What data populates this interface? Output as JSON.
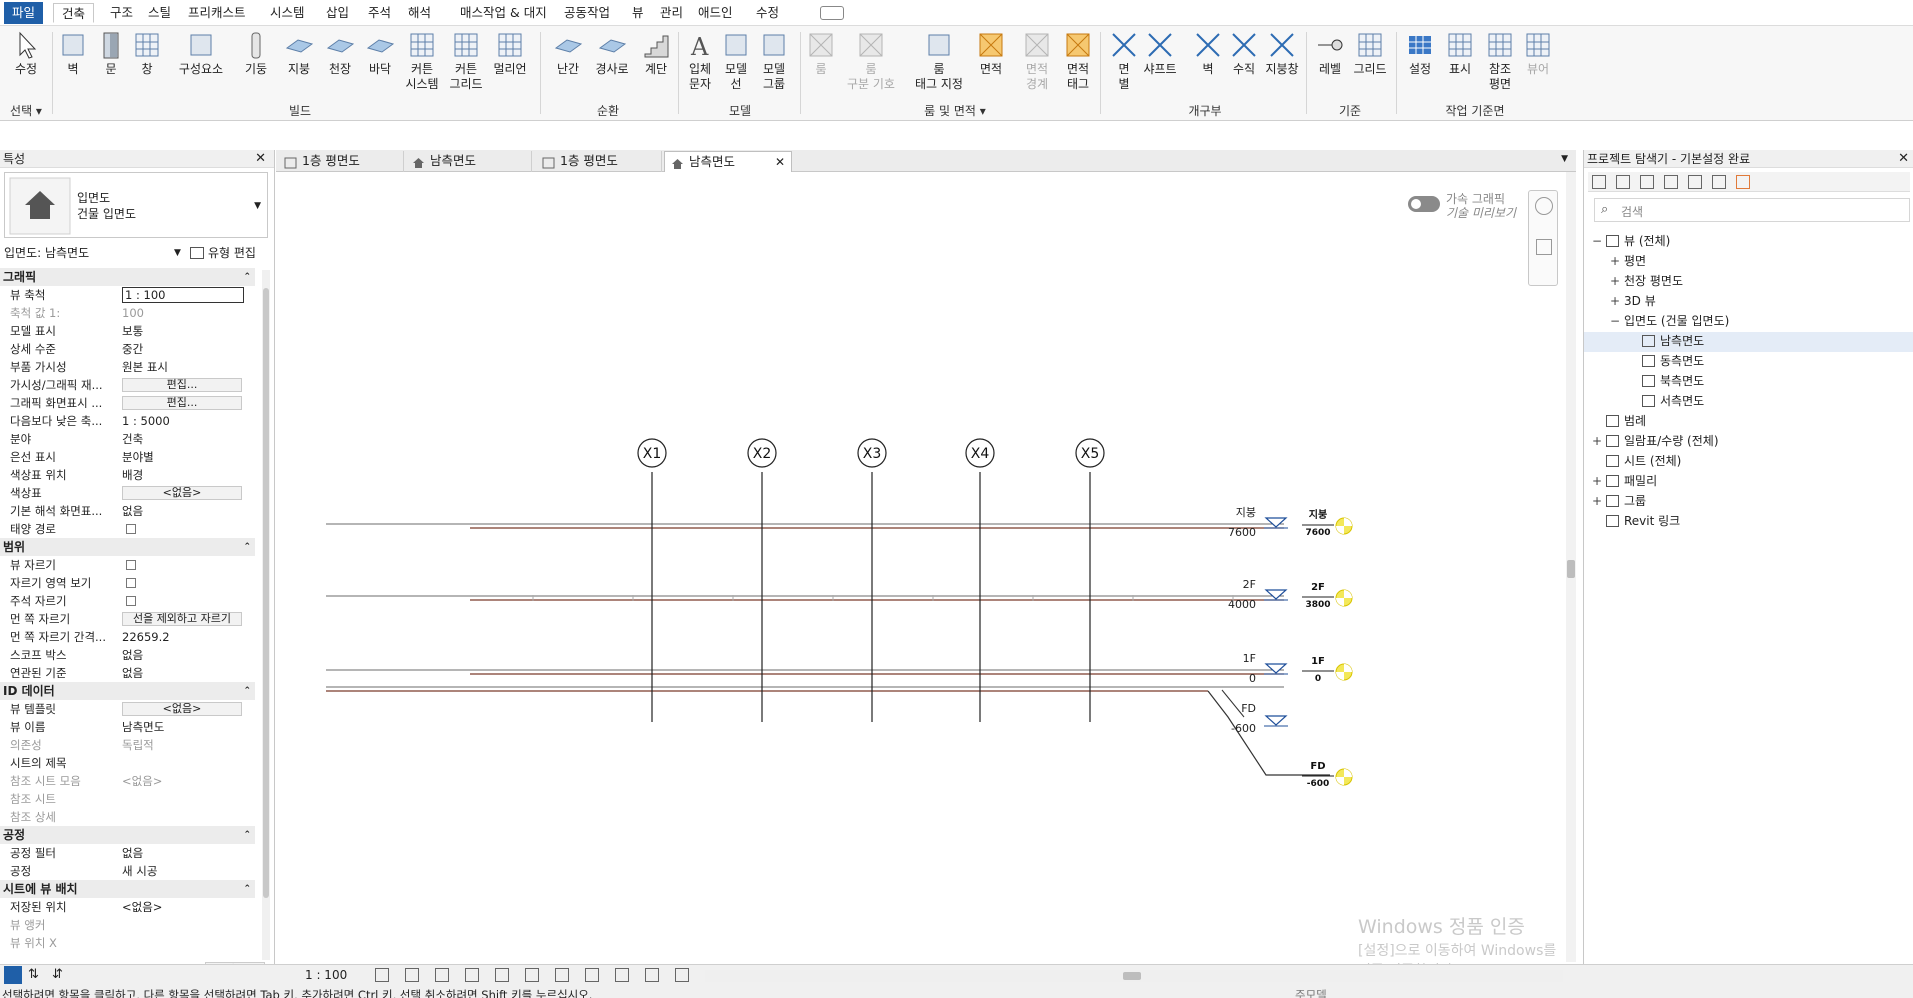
{
  "menu": {
    "file": "파일",
    "tabs": [
      "건축",
      "구조",
      "스틸",
      "프리캐스트",
      "시스템",
      "삽입",
      "주석",
      "해석",
      "매스작업 & 대지",
      "공동작업",
      "뷰",
      "관리",
      "애드인",
      "수정"
    ],
    "active": "건축"
  },
  "ribbon": {
    "select": {
      "modify": "수정",
      "group": "선택"
    },
    "build": [
      "벽",
      "문",
      "창",
      "구성요소",
      "기둥",
      "지붕",
      "천장",
      "바닥",
      "커튼\n시스템",
      "커튼\n그리드",
      "멀리언"
    ],
    "build_group": "빌드",
    "circulation": [
      "난간",
      "경사로",
      "계단"
    ],
    "circulation_group": "순환",
    "model": [
      "입체\n문자",
      "모델\n선",
      "모델\n그룹"
    ],
    "model_group": "모델",
    "room": [
      "룸",
      "룸\n구분 기호",
      "룸\n태그 지정",
      "면적",
      "면적\n경계",
      "면적\n태그"
    ],
    "room_group": "룸 및 면적",
    "opening": [
      "면\n별",
      "샤프트",
      "벽",
      "수직",
      "지붕창"
    ],
    "opening_group": "개구부",
    "datum": [
      "레벨",
      "그리드"
    ],
    "datum_group": "기준",
    "workplane": [
      "설정",
      "표시",
      "참조\n평면",
      "뷰어"
    ],
    "workplane_group": "작업 기준면"
  },
  "properties": {
    "title": "특성",
    "type_name": "입면도",
    "type_sub": "건물 입면도",
    "selector": "입면도: 남측면도",
    "edit_type": "유형 편집",
    "apply": "적용",
    "sections": [
      {
        "name": "그래픽",
        "rows": [
          {
            "k": "뷰 축척",
            "v": "1 : 100",
            "kind": "input"
          },
          {
            "k": "축척 값    1:",
            "v": "100",
            "kind": "gray"
          },
          {
            "k": "모델 표시",
            "v": "보통"
          },
          {
            "k": "상세 수준",
            "v": "중간"
          },
          {
            "k": "부품 가시성",
            "v": "원본 표시"
          },
          {
            "k": "가시성/그래픽 재...",
            "v": "편집...",
            "kind": "btn"
          },
          {
            "k": "그래픽 화면표시 ...",
            "v": "편집...",
            "kind": "btn"
          },
          {
            "k": "다음보다 낮은 축...",
            "v": "1 : 5000"
          },
          {
            "k": "분야",
            "v": "건축"
          },
          {
            "k": "은선 표시",
            "v": "분야별"
          },
          {
            "k": "색상표 위치",
            "v": "배경"
          },
          {
            "k": "색상표",
            "v": "<없음>",
            "kind": "btn"
          },
          {
            "k": "기본 해석 화면표...",
            "v": "없음"
          },
          {
            "k": "태양 경로",
            "v": "",
            "kind": "cb"
          }
        ]
      },
      {
        "name": "범위",
        "rows": [
          {
            "k": "뷰 자르기",
            "v": "",
            "kind": "cb"
          },
          {
            "k": "자르기 영역 보기",
            "v": "",
            "kind": "cb"
          },
          {
            "k": "주석 자르기",
            "v": "",
            "kind": "cb"
          },
          {
            "k": "먼 쪽 자르기",
            "v": "선을 제외하고 자르기",
            "kind": "btn"
          },
          {
            "k": "먼 쪽 자르기 간격...",
            "v": "22659.2"
          },
          {
            "k": "스코프 박스",
            "v": "없음"
          },
          {
            "k": "연관된 기준",
            "v": "없음"
          }
        ]
      },
      {
        "name": "ID 데이터",
        "rows": [
          {
            "k": "뷰 템플릿",
            "v": "<없음>",
            "kind": "btn"
          },
          {
            "k": "뷰 이름",
            "v": "남측면도"
          },
          {
            "k": "의존성",
            "v": "독립적",
            "kind": "gray"
          },
          {
            "k": "시트의 제목",
            "v": ""
          },
          {
            "k": "참조 시트 모음",
            "v": "<없음>",
            "kind": "gray"
          },
          {
            "k": "참조 시트",
            "v": "",
            "kind": "gray"
          },
          {
            "k": "참조 상세",
            "v": "",
            "kind": "gray"
          }
        ]
      },
      {
        "name": "공정",
        "rows": [
          {
            "k": "공정 필터",
            "v": "없음"
          },
          {
            "k": "공정",
            "v": "새 시공"
          }
        ]
      },
      {
        "name": "시트에 뷰 배치",
        "rows": [
          {
            "k": "저장된 위치",
            "v": "<없음>"
          },
          {
            "k": "뷰 앵커",
            "v": "",
            "kind": "gray"
          },
          {
            "k": "뷰 위치 X",
            "v": "",
            "kind": "gray"
          }
        ]
      }
    ]
  },
  "tabs": [
    {
      "label": "1층 평면도",
      "icon": "plan"
    },
    {
      "label": "남측면도",
      "icon": "elev"
    },
    {
      "label": "1층 평면도",
      "icon": "plan"
    },
    {
      "label": "남측면도",
      "icon": "elev",
      "active": true
    }
  ],
  "canvas": {
    "toggle_label": "가속 그래픽",
    "toggle_sub": "기술 미리보기",
    "grids": [
      "X1",
      "X2",
      "X3",
      "X4",
      "X5"
    ],
    "levels": [
      {
        "name": "지붕",
        "elev": "7600",
        "tag": "지붕",
        "tagv": "7600"
      },
      {
        "name": "2F",
        "elev": "4000",
        "tag": "2F",
        "tagv": "3800"
      },
      {
        "name": "1F",
        "elev": "0",
        "tag": "1F",
        "tagv": "0"
      },
      {
        "name": "FD",
        "elev": "-600",
        "tag": "FD",
        "tagv": "-600"
      }
    ],
    "watermark_title": "Windows 정품 인증",
    "watermark_sub": "[설정]으로 이동하여 Windows를 정품 인증합니다.",
    "scale": "1 : 100"
  },
  "browser": {
    "title": "프로젝트 탐색기 - 기본설정 완료",
    "search": "검색",
    "tree": [
      {
        "t": "뷰 (전체)",
        "lvl": 0,
        "pm": "−",
        "icon": true
      },
      {
        "t": "평면",
        "lvl": 1,
        "pm": "+"
      },
      {
        "t": "천장 평면도",
        "lvl": 1,
        "pm": "+"
      },
      {
        "t": "3D 뷰",
        "lvl": 1,
        "pm": "+"
      },
      {
        "t": "입면도 (건물 입면도)",
        "lvl": 1,
        "pm": "−"
      },
      {
        "t": "남측면도",
        "lvl": 2,
        "pm": "",
        "sel": true,
        "icon": true
      },
      {
        "t": "동측면도",
        "lvl": 2,
        "pm": "",
        "icon": true
      },
      {
        "t": "북측면도",
        "lvl": 2,
        "pm": "",
        "icon": true
      },
      {
        "t": "서측면도",
        "lvl": 2,
        "pm": "",
        "icon": true
      },
      {
        "t": "범례",
        "lvl": 0,
        "pm": "",
        "icon": true
      },
      {
        "t": "일람표/수량 (전체)",
        "lvl": 0,
        "pm": "+",
        "icon": true
      },
      {
        "t": "시트 (전체)",
        "lvl": 0,
        "pm": "",
        "icon": true
      },
      {
        "t": "패밀리",
        "lvl": 0,
        "pm": "+",
        "icon": true
      },
      {
        "t": "그룹",
        "lvl": 0,
        "pm": "+",
        "icon": true
      },
      {
        "t": "Revit 링크",
        "lvl": 0,
        "pm": "",
        "icon": true
      }
    ]
  },
  "status": {
    "hint": "선택하려면 항목을 클릭하고, 다른 항목을 선택하려면 Tab 키, 추가하려면 Ctrl 키, 선택 취소하려면 Shift 키를 누르십시오.",
    "model": "주모델"
  },
  "colors": {
    "accent": "#1f5fa8",
    "level_line": "#7a3b2a",
    "tag": "#f3e85a"
  }
}
